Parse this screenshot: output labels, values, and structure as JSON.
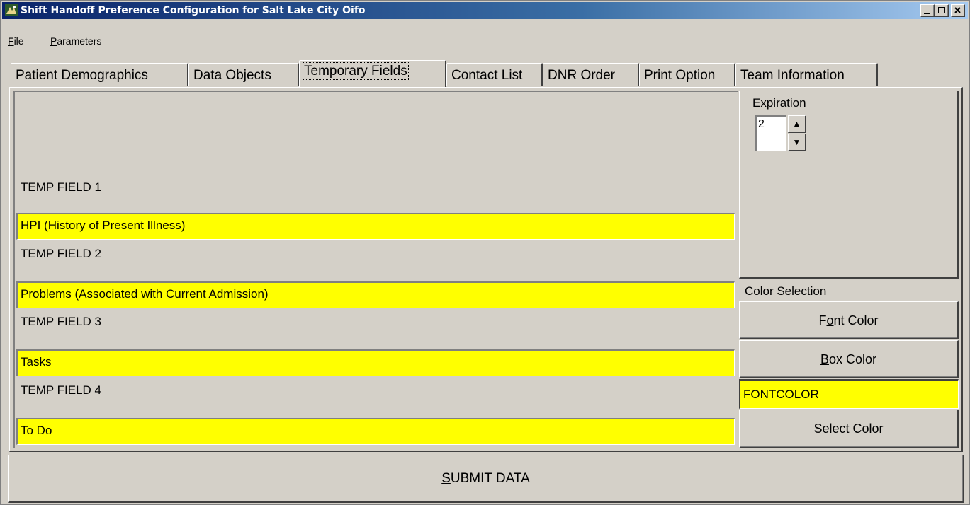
{
  "window": {
    "title": "Shift Handoff Preference Configuration for Salt Lake City Oifo",
    "minimize_label": "_",
    "maximize_label": "□",
    "close_label": "×"
  },
  "menu": {
    "file": {
      "accel": "F",
      "rest": "ile"
    },
    "parameters": {
      "accel": "P",
      "rest": "arameters"
    }
  },
  "tabs": [
    {
      "label": "Patient Demographics"
    },
    {
      "label": "Data Objects"
    },
    {
      "label": "Temporary Fields",
      "active": true
    },
    {
      "label": "Contact List"
    },
    {
      "label": "DNR Order"
    },
    {
      "label": "Print Option"
    },
    {
      "label": "Team Information"
    }
  ],
  "temp_fields": [
    {
      "label": "TEMP FIELD 1",
      "value": "HPI  (History of Present Illness)"
    },
    {
      "label": "TEMP FIELD 2",
      "value": "Problems (Associated with Current Admission)"
    },
    {
      "label": "TEMP FIELD 3",
      "value": "Tasks"
    },
    {
      "label": "TEMP FIELD 4",
      "value": "To Do"
    }
  ],
  "expiration": {
    "label": "Expiration",
    "value": "2",
    "up_glyph": "▲",
    "down_glyph": "▼"
  },
  "color_selection": {
    "label": "Color Selection",
    "font_color_btn": {
      "pre": "F",
      "accel": "o",
      "post": "nt Color"
    },
    "box_color_btn": {
      "pre": "",
      "accel": "B",
      "post": "ox Color"
    },
    "font_color_value": "FONTCOLOR",
    "select_color_btn": {
      "pre": "Se",
      "accel": "l",
      "post": "ect Color"
    }
  },
  "submit": {
    "accel": "S",
    "rest": "UBMIT DATA"
  },
  "colors": {
    "title_start": "#0a246a",
    "title_end": "#a6caf0",
    "field_bg": "#ffff00",
    "face": "#d4d0c8"
  }
}
